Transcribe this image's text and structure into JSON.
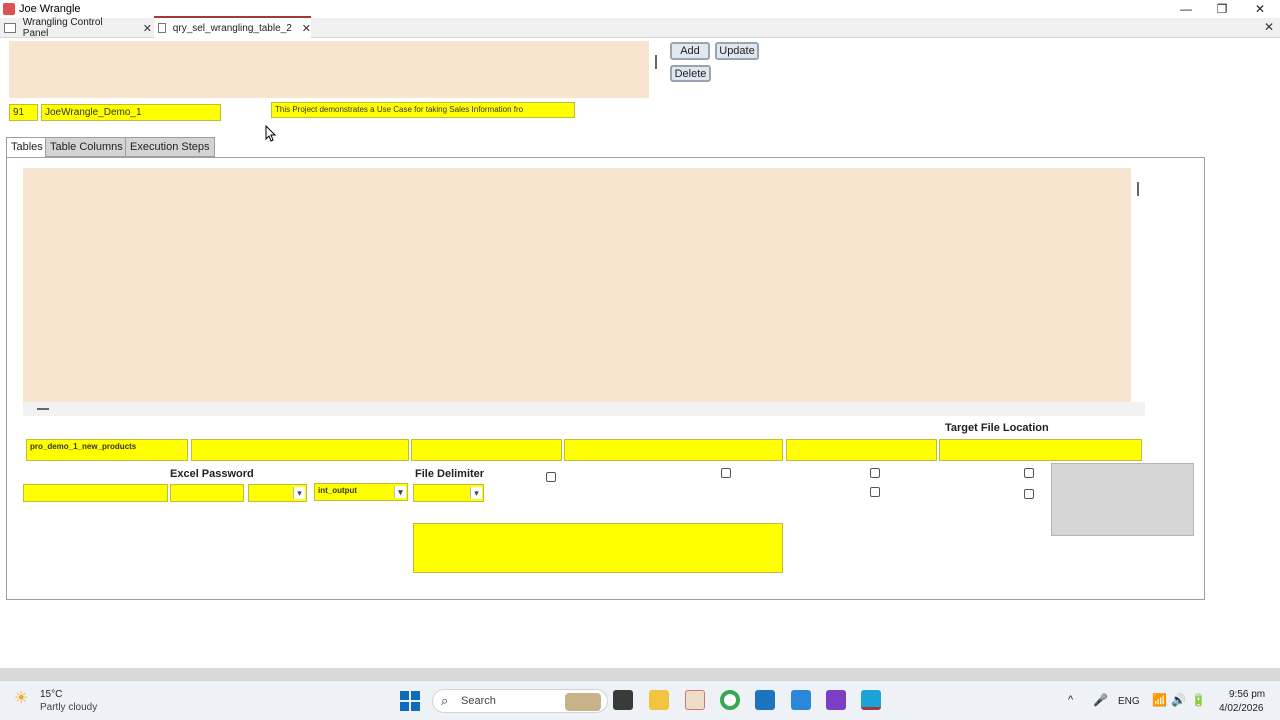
{
  "window": {
    "title": "Joe Wrangle",
    "minimize_glyph": "—",
    "maximize_glyph": "❐",
    "close_glyph": "✕"
  },
  "doc_tabs": [
    {
      "label": "Wrangling Control Panel",
      "icon": "form-icon"
    },
    {
      "label": "qry_sel_wrangling_table_2",
      "icon": "query-icon",
      "active": true
    }
  ],
  "header": {
    "buttons": {
      "add": "Add",
      "update": "Update",
      "delete": "Delete"
    },
    "project_id": "91",
    "project_name": "JoeWrangle_Demo_1",
    "project_description": "This Project demonstrates a Use Case for taking Sales Information fro"
  },
  "form_tabs": [
    "Tables",
    "Table Columns",
    "Execution Steps"
  ],
  "detail": {
    "table_name": "pro_demo_1_new_products",
    "labels": {
      "target_file_location": "Target File Location",
      "excel_password": "Excel Password",
      "file_delimiter": "File Delimiter"
    },
    "output_combo": "int_output"
  },
  "taskbar": {
    "weather_temp": "15°C",
    "weather_desc": "Partly cloudy",
    "search_placeholder": "Search",
    "lang": "ENG",
    "time": "9:56 pm",
    "date": "4/02/2026"
  },
  "colors": {
    "field_yellow": "#ffff00",
    "subform_peach": "#f7e5d0",
    "active_tab_accent": "#a4373a"
  }
}
